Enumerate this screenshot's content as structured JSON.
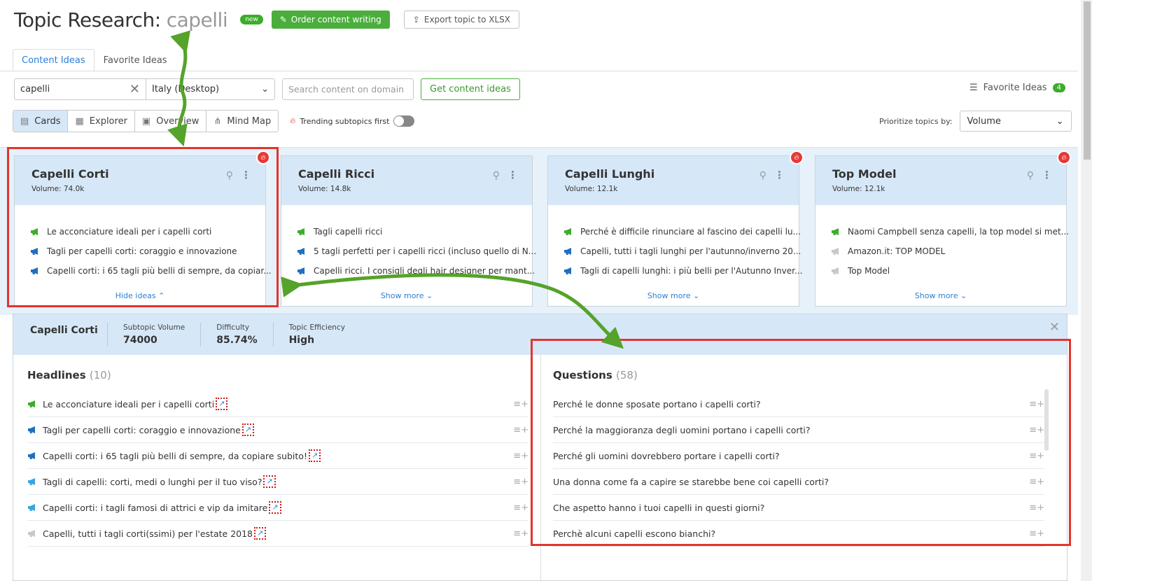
{
  "header": {
    "title": "Topic Research:",
    "keyword": "capelli",
    "new_badge": "new",
    "order_button": "Order content writing",
    "export_button": "Export topic to XLSX"
  },
  "tabs": [
    {
      "label": "Content Ideas",
      "active": true
    },
    {
      "label": "Favorite Ideas",
      "active": false
    }
  ],
  "search": {
    "keyword_value": "capelli",
    "country_value": "Italy (Desktop)",
    "domain_placeholder": "Search content on domain",
    "get_button": "Get content ideas"
  },
  "favorites": {
    "label": "Favorite Ideas",
    "count": "4"
  },
  "views": [
    {
      "label": "Cards",
      "icon": "cards-icon",
      "active": true
    },
    {
      "label": "Explorer",
      "icon": "table-icon",
      "active": false
    },
    {
      "label": "Overview",
      "icon": "overview-icon",
      "active": false
    },
    {
      "label": "Mind Map",
      "icon": "mindmap-icon",
      "active": false
    }
  ],
  "trending": {
    "label": "Trending subtopics first",
    "enabled": false
  },
  "prioritize": {
    "label": "Prioritize topics by:",
    "value": "Volume"
  },
  "cards": [
    {
      "title": "Capelli Corti",
      "volume": "Volume: 74.0k",
      "trending": true,
      "footer": "Hide ideas",
      "ideas": [
        {
          "text": "Le acconciature ideali per i capelli corti",
          "icon": "green"
        },
        {
          "text": "Tagli per capelli corti: coraggio e innovazione",
          "icon": "blue"
        },
        {
          "text": "Capelli corti: i 65 tagli più belli di sempre, da copiar...",
          "icon": "blue"
        }
      ]
    },
    {
      "title": "Capelli Ricci",
      "volume": "Volume: 14.8k",
      "trending": false,
      "footer": "Show more",
      "ideas": [
        {
          "text": "Tagli capelli ricci",
          "icon": "green"
        },
        {
          "text": "5 tagli perfetti per i capelli ricci (incluso quello di N...",
          "icon": "blue"
        },
        {
          "text": "Capelli ricci. I consigli degli hair designer per mant...",
          "icon": "blue"
        }
      ]
    },
    {
      "title": "Capelli Lunghi",
      "volume": "Volume: 12.1k",
      "trending": true,
      "footer": "Show more",
      "ideas": [
        {
          "text": "Perché è difficile rinunciare al fascino dei capelli lu...",
          "icon": "green"
        },
        {
          "text": "Capelli, tutti i tagli lunghi per l'autunno/inverno 20...",
          "icon": "blue"
        },
        {
          "text": "Tagli di capelli lunghi: i più belli per l'Autunno Inver...",
          "icon": "blue"
        }
      ]
    },
    {
      "title": "Top Model",
      "volume": "Volume: 12.1k",
      "trending": true,
      "footer": "Show more",
      "ideas": [
        {
          "text": "Naomi Campbell senza capelli, la top model si met...",
          "icon": "green"
        },
        {
          "text": "Amazon.it: TOP MODEL",
          "icon": "gray"
        },
        {
          "text": "Top Model",
          "icon": "gray"
        }
      ]
    }
  ],
  "detail": {
    "title": "Capelli Corti",
    "metrics": [
      {
        "label": "Subtopic Volume",
        "value": "74000"
      },
      {
        "label": "Difficulty",
        "value": "85.74%"
      },
      {
        "label": "Topic Efficiency",
        "value": "High"
      }
    ],
    "headlines": {
      "title": "Headlines",
      "count": "(10)",
      "items": [
        {
          "text": "Le acconciature ideali per i capelli corti",
          "icon": "green"
        },
        {
          "text": "Tagli per capelli corti: coraggio e innovazione",
          "icon": "blue"
        },
        {
          "text": "Capelli corti: i 65 tagli più belli di sempre, da copiare subito!",
          "icon": "blue"
        },
        {
          "text": "Tagli di capelli: corti, medi o lunghi per il tuo viso?",
          "icon": "lblue"
        },
        {
          "text": "Capelli corti: i tagli famosi di attrici e vip da imitare",
          "icon": "lblue"
        },
        {
          "text": "Capelli, tutti i tagli corti(ssimi) per l'estate 2018",
          "icon": "gray"
        }
      ]
    },
    "questions": {
      "title": "Questions",
      "count": "(58)",
      "items": [
        "Perché le donne sposate portano i capelli corti?",
        "Perché la maggioranza degli uomini portano i capelli corti?",
        "Perché gli uomini dovrebbero portare i capelli corti?",
        "Una donna come fa a capire se starebbe bene coi capelli corti?",
        "Che aspetto hanno i tuoi capelli in questi giorni?",
        "Perchè alcuni capelli escono bianchi?"
      ]
    }
  },
  "colors": {
    "accent_green": "#4bae3c",
    "accent_blue": "#2d7fd2",
    "annotation_red": "#e3342f",
    "annotation_arrow": "#55a32a"
  }
}
